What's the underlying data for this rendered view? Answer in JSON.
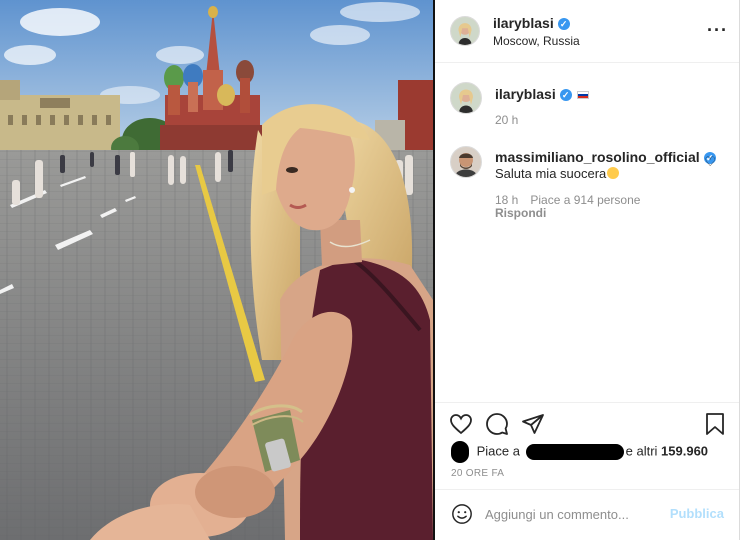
{
  "post": {
    "image_alt": "Photo in Red Square, Moscow",
    "header": {
      "username": "ilaryblasi",
      "verified": true,
      "location": "Moscow, Russia",
      "more_icon": "more-horizontal-icon"
    },
    "caption": {
      "username": "ilaryblasi",
      "flag": "russia-flag",
      "time": "20 h"
    },
    "comments": [
      {
        "username": "massimiliano_rosolino_official",
        "verified": true,
        "text": "Saluta mia suocera",
        "emoji": "smiling-face-emoji",
        "time": "18 h",
        "likes_text": "Piace a 914 persone",
        "reply_label": "Rispondi",
        "like_icon": "heart-outline-icon"
      }
    ],
    "actions": {
      "like_icon": "heart-icon",
      "comment_icon": "comment-bubble-icon",
      "share_icon": "paper-plane-icon",
      "save_icon": "bookmark-icon"
    },
    "likes": {
      "prefix": "Piace a",
      "suffix": "e altri",
      "count": "159.960"
    },
    "timestamp": "20 ORE FA",
    "comment_box": {
      "emoji_icon": "smiley-icon",
      "placeholder": "Aggiungi un commento...",
      "publish_label": "Pubblica"
    }
  },
  "colors": {
    "verified": "#3897f0",
    "publish": "#b2dffc",
    "muted": "#8e8e8e",
    "text": "#262626"
  }
}
